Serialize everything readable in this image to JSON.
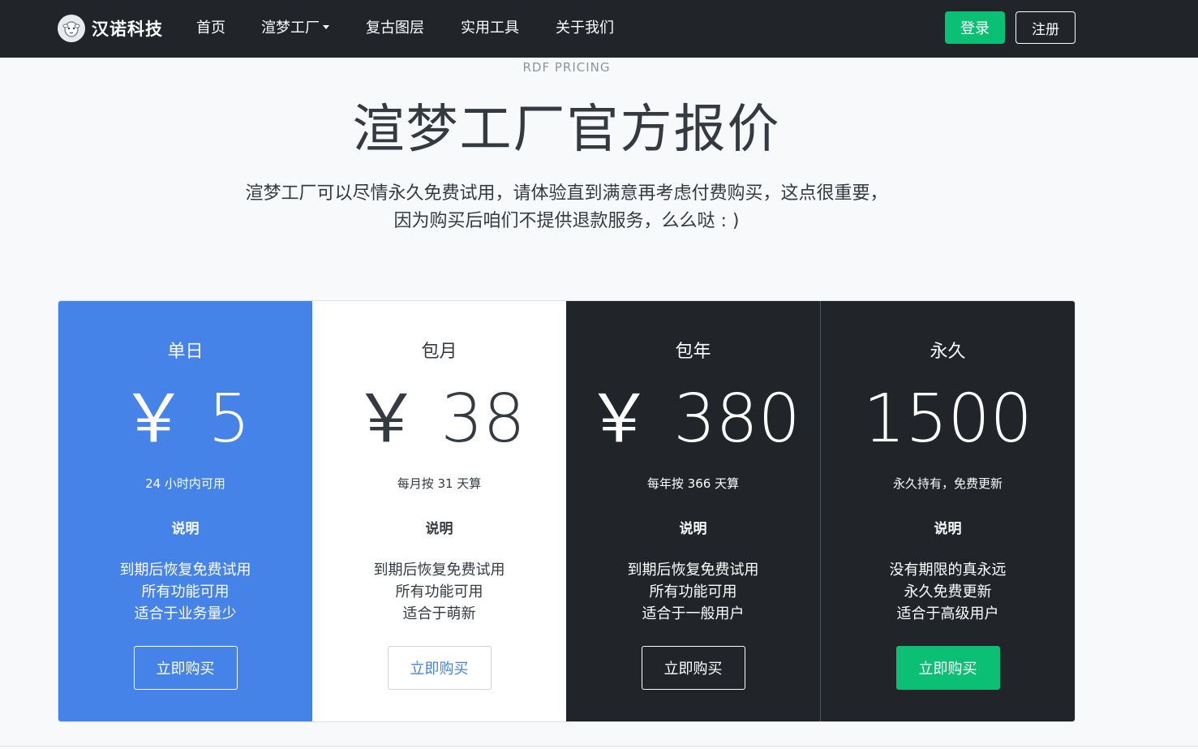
{
  "nav": {
    "brand": "汉诺科技",
    "items": [
      {
        "label": "首页",
        "dropdown": false
      },
      {
        "label": "渲梦工厂",
        "dropdown": true
      },
      {
        "label": "复古图层",
        "dropdown": false
      },
      {
        "label": "实用工具",
        "dropdown": false
      },
      {
        "label": "关于我们",
        "dropdown": false
      }
    ],
    "login": "登录",
    "register": "注册"
  },
  "hero": {
    "eyebrow": "RDF PRICING",
    "title": "渲梦工厂官方报价",
    "lead_line1": "渲梦工厂可以尽情永久免费试用，请体验直到满意再考虑付费购买，这点很重要，",
    "lead_line2": "因为购买后咱们不提供退款服务，么么哒 : )"
  },
  "plans": [
    {
      "name": "单日",
      "price": "￥ 5",
      "sub": "24 小时内可用",
      "desc_title": "说明",
      "features": [
        "到期后恢复免费试用",
        "所有功能可用",
        "适合于业务量少"
      ],
      "button": "立即购买"
    },
    {
      "name": "包月",
      "price": "￥ 38",
      "sub": "每月按 31 天算",
      "desc_title": "说明",
      "features": [
        "到期后恢复免费试用",
        "所有功能可用",
        "适合于萌新"
      ],
      "button": "立即购买"
    },
    {
      "name": "包年",
      "price": "￥ 380",
      "sub": "每年按 366 天算",
      "desc_title": "说明",
      "features": [
        "到期后恢复免费试用",
        "所有功能可用",
        "适合于一般用户"
      ],
      "button": "立即购买"
    },
    {
      "name": "永久",
      "price": "1500",
      "sub": "永久持有，免费更新",
      "desc_title": "说明",
      "features": [
        "没有期限的真永远",
        "永久免费更新",
        "适合于高级用户"
      ],
      "button": "立即购买"
    }
  ],
  "colors": {
    "navbar": "#212529",
    "accent_green": "#0bbf74",
    "plan_blue": "#4583e8",
    "plan_dark": "#212529"
  }
}
